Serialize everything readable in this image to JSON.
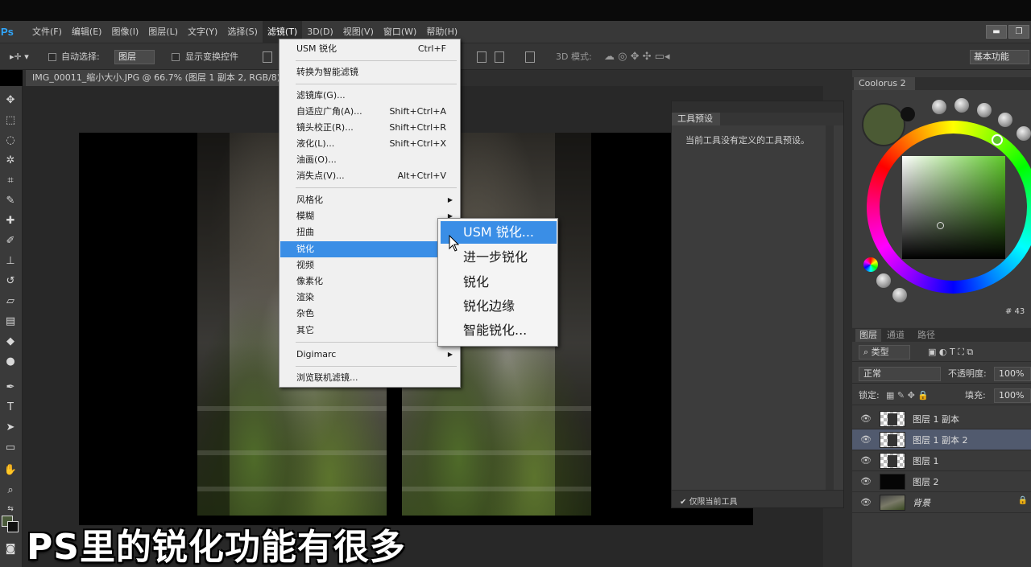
{
  "app": {
    "logo": "Ps"
  },
  "menubar": {
    "items": [
      {
        "label": "文件(F)"
      },
      {
        "label": "编辑(E)"
      },
      {
        "label": "图像(I)"
      },
      {
        "label": "图层(L)"
      },
      {
        "label": "文字(Y)"
      },
      {
        "label": "选择(S)"
      },
      {
        "label": "滤镜(T)"
      },
      {
        "label": "3D(D)"
      },
      {
        "label": "视图(V)"
      },
      {
        "label": "窗口(W)"
      },
      {
        "label": "帮助(H)"
      }
    ],
    "window_buttons": [
      "▬",
      "❐"
    ]
  },
  "options_bar": {
    "auto_select_label": "自动选择:",
    "auto_select_value": "图层",
    "show_transform_label": "显示变换控件",
    "mode_3d_label": "3D 模式:",
    "workspace": "基本功能"
  },
  "document": {
    "tab_title": "IMG_00011_缩小大小.JPG @ 66.7% (图层 1 副本 2, RGB/8)"
  },
  "filter_menu": {
    "items": [
      {
        "label": "USM 锐化",
        "shortcut": "Ctrl+F"
      },
      {
        "label": "转换为智能滤镜",
        "shortcut": ""
      },
      {
        "label": "滤镜库(G)...",
        "shortcut": ""
      },
      {
        "label": "自适应广角(A)...",
        "shortcut": "Shift+Ctrl+A"
      },
      {
        "label": "镜头校正(R)...",
        "shortcut": "Shift+Ctrl+R"
      },
      {
        "label": "液化(L)...",
        "shortcut": "Shift+Ctrl+X"
      },
      {
        "label": "油画(O)...",
        "shortcut": ""
      },
      {
        "label": "消失点(V)...",
        "shortcut": "Alt+Ctrl+V"
      },
      {
        "label": "风格化",
        "submenu": true
      },
      {
        "label": "模糊",
        "submenu": true
      },
      {
        "label": "扭曲",
        "submenu": true
      },
      {
        "label": "锐化",
        "submenu": true,
        "highlighted": true
      },
      {
        "label": "视频",
        "submenu": true
      },
      {
        "label": "像素化",
        "submenu": true
      },
      {
        "label": "渲染",
        "submenu": true
      },
      {
        "label": "杂色",
        "submenu": true
      },
      {
        "label": "其它",
        "submenu": true
      },
      {
        "label": "Digimarc",
        "submenu": true
      },
      {
        "label": "浏览联机滤镜..."
      }
    ]
  },
  "sharpen_submenu": {
    "items": [
      {
        "label": "USM 锐化...",
        "highlighted": true
      },
      {
        "label": "进一步锐化"
      },
      {
        "label": "锐化"
      },
      {
        "label": "锐化边缘"
      },
      {
        "label": "智能锐化..."
      }
    ]
  },
  "tool_presets": {
    "tab": "工具预设",
    "message": "当前工具没有定义的工具预设。",
    "footer_checkbox": "仅限当前工具"
  },
  "coolorus": {
    "tab": "Coolorus 2",
    "hex_partial": "# 43",
    "foreground": "#4b5a34",
    "background": "#111111"
  },
  "layers_panel": {
    "tabs": [
      "图层",
      "通道",
      "路径"
    ],
    "filter_label": "类型",
    "blend_mode": "正常",
    "opacity_label": "不透明度:",
    "opacity": "100%",
    "lock_label": "锁定:",
    "fill_label": "填充:",
    "fill": "100%",
    "layers": [
      {
        "name": "图层 1 副本",
        "selected": false
      },
      {
        "name": "图层 1 副本 2",
        "selected": true
      },
      {
        "name": "图层 1",
        "selected": false
      },
      {
        "name": "图层 2",
        "selected": false
      },
      {
        "name": "背景",
        "selected": false,
        "locked": true
      }
    ]
  },
  "subtitle": "PS里的锐化功能有很多",
  "colors": {
    "menu_highlight": "#3a8ee6",
    "accent_ps": "#31a8ff"
  }
}
